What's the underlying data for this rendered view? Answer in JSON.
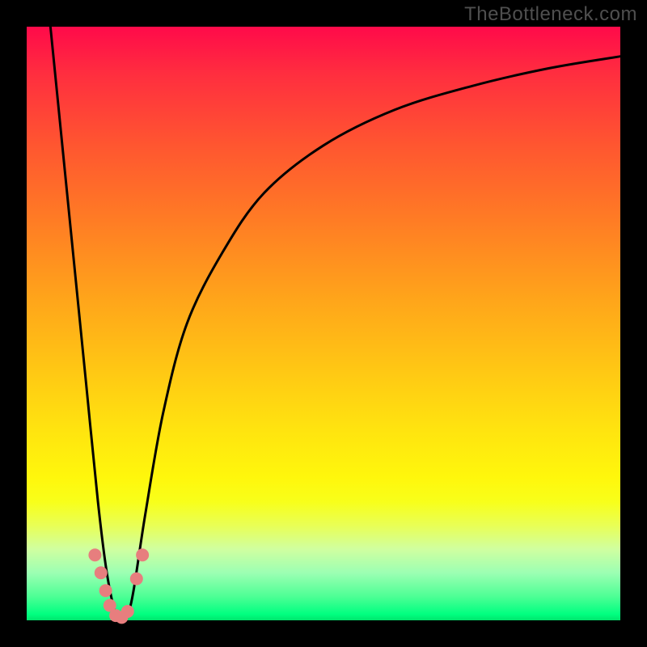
{
  "watermark": "TheBottleneck.com",
  "chart_data": {
    "type": "line",
    "title": "",
    "xlabel": "",
    "ylabel": "",
    "xlim": [
      0,
      100
    ],
    "ylim": [
      0,
      100
    ],
    "series": [
      {
        "name": "bottleneck-curve",
        "x": [
          4,
          6,
          8,
          10,
          12,
          13.5,
          15,
          16,
          17,
          18,
          20,
          23,
          27,
          33,
          40,
          50,
          62,
          75,
          88,
          100
        ],
        "values": [
          100,
          80,
          60,
          40,
          20,
          8,
          1,
          0,
          1,
          5,
          18,
          35,
          50,
          62,
          72,
          80,
          86,
          90,
          93,
          95
        ]
      }
    ],
    "markers": {
      "name": "highlighted-points",
      "color": "#e77e7e",
      "x": [
        11.5,
        12.5,
        13.3,
        14.0,
        15.0,
        16.0,
        17.0,
        18.5,
        19.5
      ],
      "values": [
        11.0,
        8.0,
        5.0,
        2.5,
        0.8,
        0.5,
        1.5,
        7.0,
        11.0
      ]
    },
    "gradient_stops": [
      {
        "pos": 0,
        "color": "#ff0a4a"
      },
      {
        "pos": 20,
        "color": "#ff5630"
      },
      {
        "pos": 46,
        "color": "#ffa51a"
      },
      {
        "pos": 76,
        "color": "#fff70c"
      },
      {
        "pos": 92,
        "color": "#9cffb3"
      },
      {
        "pos": 100,
        "color": "#00e46c"
      }
    ]
  }
}
